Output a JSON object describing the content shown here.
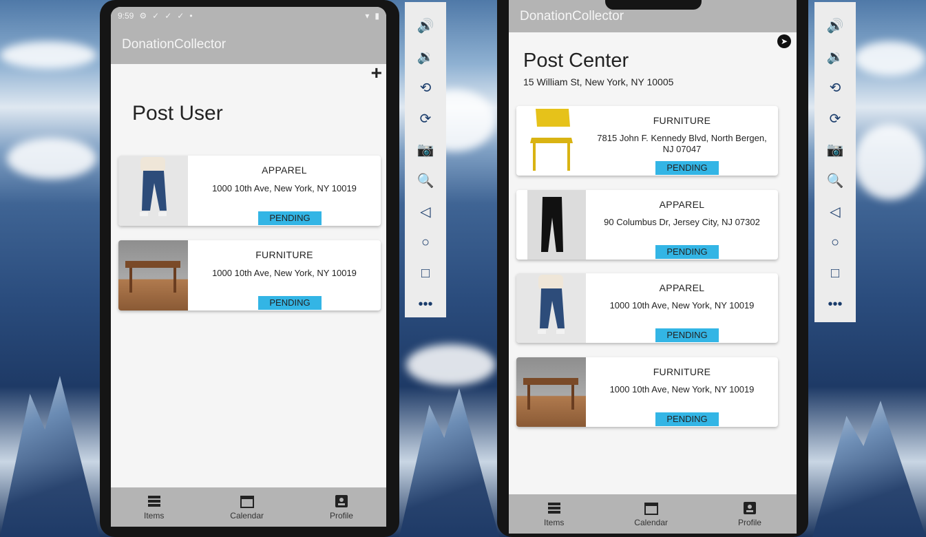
{
  "left_phone": {
    "status": {
      "time": "9:59"
    },
    "app_title": "DonationCollector",
    "page_title": "Post User",
    "add_icon": "plus-icon",
    "cards": [
      {
        "category": "APPAREL",
        "address": "1000 10th Ave, New York, NY 10019",
        "status": "PENDING",
        "thumb": "jeans-model"
      },
      {
        "category": "FURNITURE",
        "address": "1000 10th Ave, New York, NY 10019",
        "status": "PENDING",
        "thumb": "wooden-desk"
      }
    ],
    "nav": [
      {
        "label": "Items",
        "icon": "list-icon"
      },
      {
        "label": "Calendar",
        "icon": "calendar-icon"
      },
      {
        "label": "Profile",
        "icon": "profile-icon"
      }
    ]
  },
  "right_phone": {
    "app_title": "DonationCollector",
    "page_title": "Post Center",
    "page_subtitle": "15 William St, New York, NY 10005",
    "corner_icon": "compass-icon",
    "cards": [
      {
        "category": "FURNITURE",
        "address": "7815 John F. Kennedy Blvd, North Bergen, NJ 07047",
        "status": "PENDING",
        "thumb": "yellow-chair"
      },
      {
        "category": "APPAREL",
        "address": "90 Columbus Dr, Jersey City, NJ 07302",
        "status": "PENDING",
        "thumb": "black-pants"
      },
      {
        "category": "APPAREL",
        "address": "1000 10th Ave, New York, NY 10019",
        "status": "PENDING",
        "thumb": "jeans-model"
      },
      {
        "category": "FURNITURE",
        "address": "1000 10th Ave, New York, NY 10019",
        "status": "PENDING",
        "thumb": "wooden-desk"
      }
    ],
    "nav": [
      {
        "label": "Items",
        "icon": "list-icon"
      },
      {
        "label": "Calendar",
        "icon": "calendar-icon"
      },
      {
        "label": "Profile",
        "icon": "profile-icon"
      }
    ]
  },
  "emulator_toolbar": {
    "tools": [
      "volume-up-icon",
      "volume-down-icon",
      "rotate-left-icon",
      "rotate-right-icon",
      "camera-icon",
      "zoom-icon",
      "back-icon",
      "home-icon",
      "overview-icon",
      "more-icon"
    ]
  },
  "colors": {
    "appbar": "#b4b4b4",
    "pending": "#33b5e5",
    "background": "#f5f5f5"
  }
}
